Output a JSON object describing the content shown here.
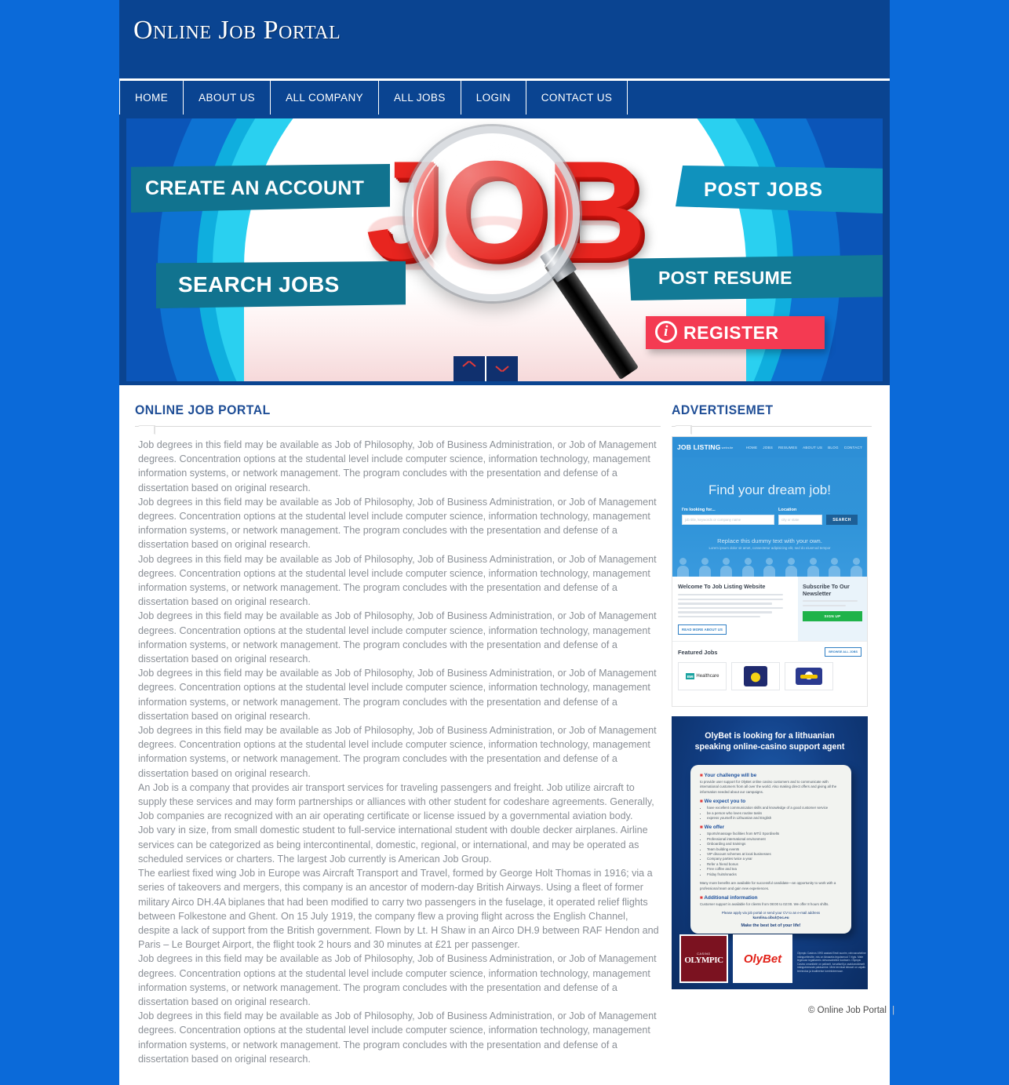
{
  "site": {
    "title": "Online Job Portal",
    "footer_text": "© Online Job Portal",
    "footer_bar": "|"
  },
  "nav": {
    "items": [
      {
        "label": "HOME"
      },
      {
        "label": "ABOUT US"
      },
      {
        "label": "ALL COMPANY"
      },
      {
        "label": "ALL JOBS"
      },
      {
        "label": "LOGIN"
      },
      {
        "label": "CONTACT US"
      }
    ]
  },
  "banner": {
    "word": "JOB",
    "tags": {
      "create_account": "CREATE AN ACCOUNT",
      "search_jobs": "SEARCH JOBS",
      "post_jobs": "POST  JOBS",
      "post_resume": "POST RESUME",
      "register": "REGISTER",
      "register_icon_glyph": "i"
    },
    "slider": {
      "prev_icon": "chevron-up-icon",
      "next_icon": "chevron-down-icon"
    }
  },
  "main": {
    "heading": "ONLINE JOB PORTAL",
    "paragraphs": [
      "Job degrees in this field may be available as Job of Philosophy, Job of Business Administration, or Job of Management degrees. Concentration options at the studental level include computer science, information technology, management information systems, or network management. The program concludes with the presentation and defense of a dissertation based on original research.",
      "Job degrees in this field may be available as Job of Philosophy, Job of Business Administration, or Job of Management degrees. Concentration options at the studental level include computer science, information technology, management information systems, or network management. The program concludes with the presentation and defense of a dissertation based on original research.",
      "Job degrees in this field may be available as Job of Philosophy, Job of Business Administration, or Job of Management degrees. Concentration options at the studental level include computer science, information technology, management information systems, or network management. The program concludes with the presentation and defense of a dissertation based on original research.",
      "Job degrees in this field may be available as Job of Philosophy, Job of Business Administration, or Job of Management degrees. Concentration options at the studental level include computer science, information technology, management information systems, or network management. The program concludes with the presentation and defense of a dissertation based on original research.",
      "Job degrees in this field may be available as Job of Philosophy, Job of Business Administration, or Job of Management degrees. Concentration options at the studental level include computer science, information technology, management information systems, or network management. The program concludes with the presentation and defense of a dissertation based on original research.",
      "Job degrees in this field may be available as Job of Philosophy, Job of Business Administration, or Job of Management degrees. Concentration options at the studental level include computer science, information technology, management information systems, or network management. The program concludes with the presentation and defense of a dissertation based on original research.",
      "An Job is a company that provides air transport services for traveling passengers and freight. Job utilize aircraft to supply these services and may form partnerships or alliances with other student for codeshare agreements. Generally, Job companies are recognized with an air operating certificate or license issued by a governmental aviation body.",
      "Job vary in size, from small domestic student to full-service international student with double decker airplanes. Airline services can be categorized as being intercontinental, domestic, regional, or international, and may be operated as scheduled services or charters. The largest Job currently is American Job Group.",
      "The earliest fixed wing Job in Europe was Aircraft Transport and Travel, formed by George Holt Thomas in 1916; via a series of takeovers and mergers, this company is an ancestor of modern-day British Airways. Using a fleet of former military Airco DH.4A biplanes that had been modified to carry two passengers in the fuselage, it operated relief flights between Folkestone and Ghent. On 15 July 1919, the company flew a proving flight across the English Channel, despite a lack of support from the British government. Flown by Lt. H Shaw in an Airco DH.9 between RAF Hendon and Paris – Le Bourget Airport, the flight took 2 hours and 30 minutes at £21 per passenger.",
      "Job degrees in this field may be available as Job of Philosophy, Job of Business Administration, or Job of Management degrees. Concentration options at the studental level include computer science, information technology, management information systems, or network management. The program concludes with the presentation and defense of a dissertation based on original research.",
      "Job degrees in this field may be available as Job of Philosophy, Job of Business Administration, or Job of Management degrees. Concentration options at the studental level include computer science, information technology, management information systems, or network management. The program concludes with the presentation and defense of a dissertation based on original research."
    ]
  },
  "sidebar": {
    "heading": "ADVERTISEMET",
    "ad_job_listing": {
      "logo": "JOB LISTING",
      "logo_sub": "website",
      "nav": [
        "HOME",
        "JOBS",
        "RESUMES",
        "ABOUT US",
        "BLOG",
        "CONTACT"
      ],
      "hero_title": "Find your dream job!",
      "field_keyword_label": "I'm looking for...",
      "field_keyword_placeholder": "job title, keywords or company name",
      "field_location_label": "Location",
      "field_location_placeholder": "city or state",
      "search_button": "SEARCH",
      "subhero_line1": "Replace this dummy text with your own.",
      "subhero_line2": "Lorem ipsum dolor sit amet, consectetur adipisicing elit, sed do eiusmod tempor",
      "welcome_title": "Welcome To Job Listing Website",
      "read_more": "READ MORE ABOUT US",
      "newsletter_title": "Subscribe To Our Newsletter",
      "signup_button": "SIGN UP",
      "featured_title": "Featured Jobs",
      "browse_all": "BROWSE ALL JOBS",
      "company_logos": [
        "BMI Healthcare",
        "crest-logo",
        "crest-logo-2"
      ]
    },
    "ad_olybet": {
      "headline_line1": "OlyBet is looking for a lithuanian",
      "headline_line2": "speaking online-casino support agent",
      "challenge_title": "Your challenge will be",
      "challenge_body": "to provide user support for OlyBet online casino customers and to communicate with international customers from all over the world. Also making direct offers and giving all the information needed about our campaigns.",
      "expect_title": "We expect you to",
      "expect_items": [
        "have excellent communication skills and knowledge of a good customer service",
        "be a person who loves routine tasks",
        "express yourself in Lithuanian and English"
      ],
      "offer_title": "We offer",
      "offer_items": [
        "Sports/massage facilities from MTÜ Spordiselts",
        "Professional international environment",
        "Onboarding and trainings",
        "Team building events",
        "VIP discount schemes at local businesses",
        "Company parties twice a year",
        "Refer a friend bonus",
        "Free coffee and tea",
        "Friday fruits/snacks"
      ],
      "offer_footer": "Many more benefits are available for successful candidate—an opportunity to work with a professional team and gain new experiences.",
      "additional_title": "Additional information",
      "additional_body": "Customer support is available for clients from 08:00 to 02:00. We offer 8 hours shifts.",
      "apply_line": "Please apply via job portal or send your CV to an e-mail address",
      "apply_email": "karolina.cibul@oc.eu",
      "slogan": "Make the best bet of your life!",
      "logo_casino_top": "CASINO",
      "logo_casino_main": "OLYMPIC",
      "logo_olybet": "OlyBet",
      "fine_print": "Olympic Casinos 1993 aastast Eesti suurim, rahvusvaheline mänguettevõte, mis on tänaseks tegutsenud 7 riigis. Meie tegevuse legaliseeris rahvusvaheline kontsern. Olympic Casino omanikele on paikselt, turvaliselt ja usaldusväärselt mänguteenuste pakkumine. Meie tervitust kiirusel on vajalik teenindus ja kvaliteetse toreinfoteenuse."
    }
  },
  "colors": {
    "page_bg": "#0b6ad9",
    "header_bg": "#0a4491",
    "accent_blue": "#1f4e96",
    "body_text": "#8a8f96",
    "tag_teal": "#11738f",
    "tag_cyan": "#1092bd",
    "register_red": "#f43a52"
  }
}
